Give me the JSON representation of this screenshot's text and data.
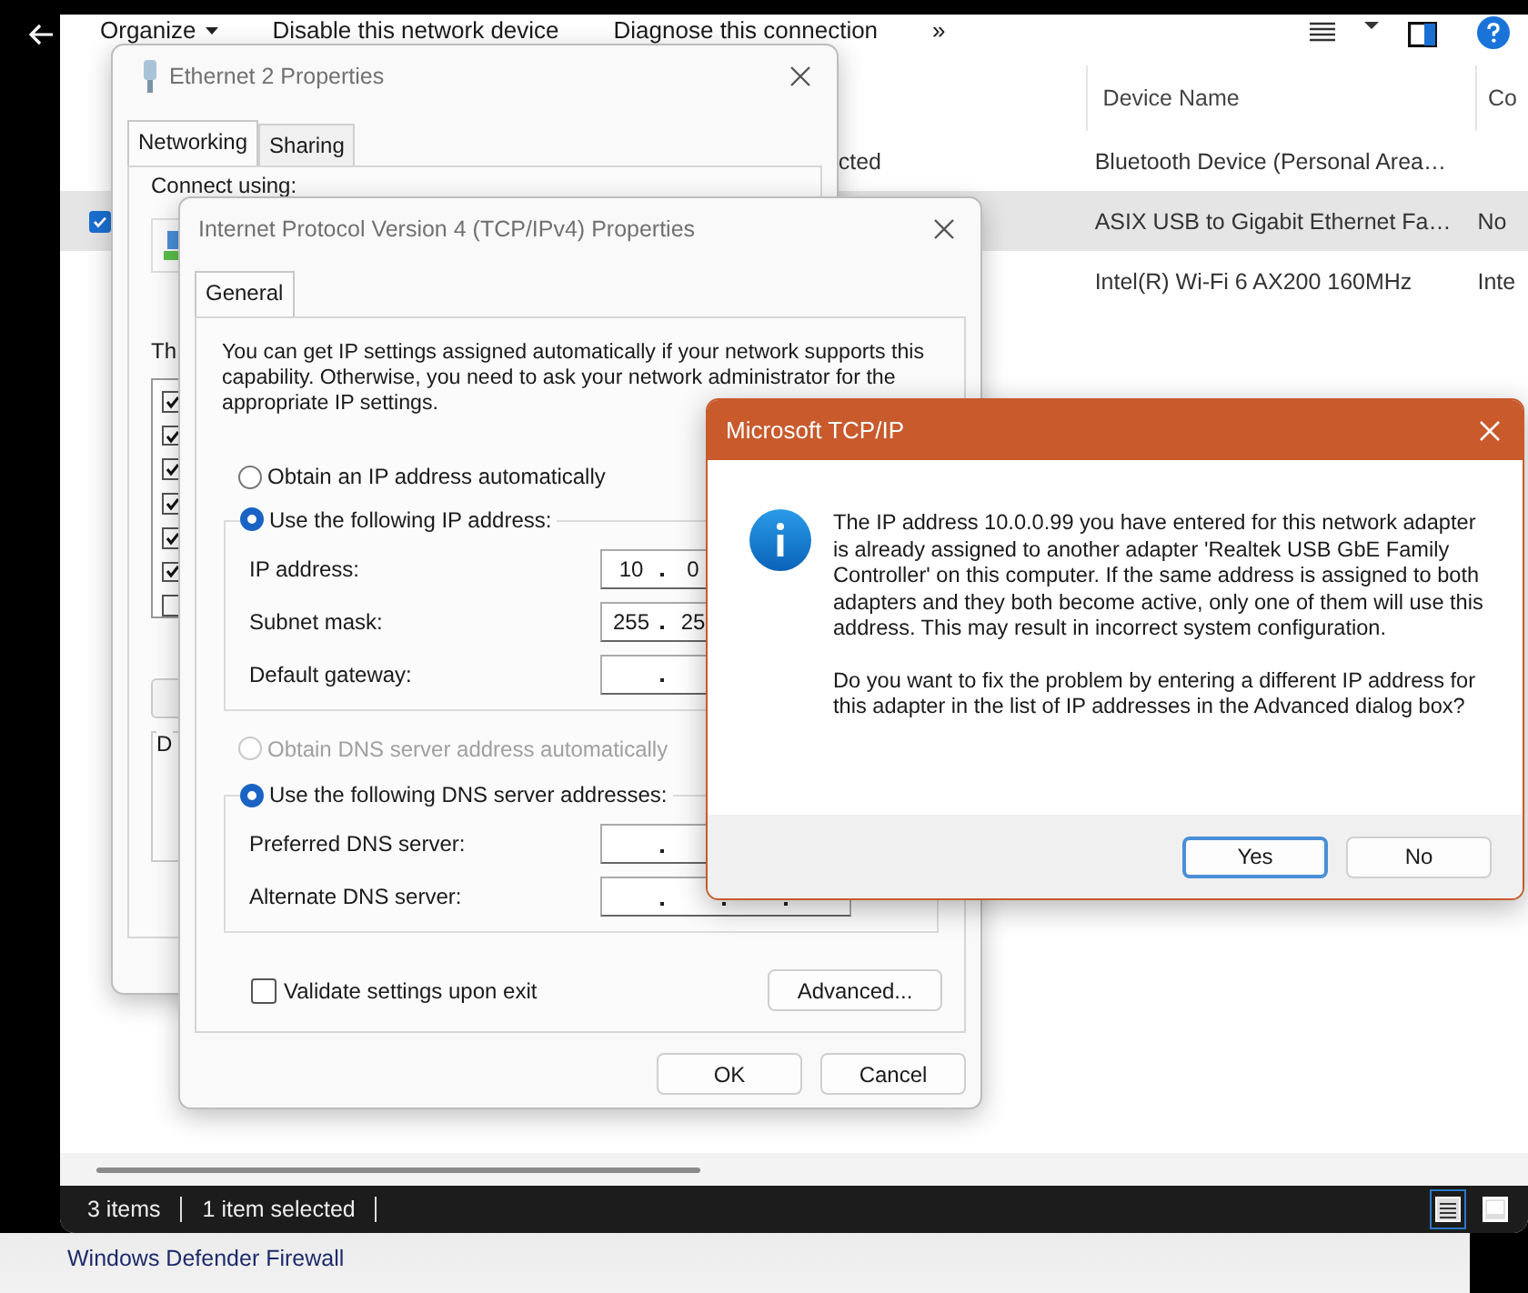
{
  "explorer": {
    "toolbar": [
      {
        "label": "Organize",
        "kind": "menu"
      },
      {
        "label": "Disable this network device",
        "kind": "command"
      },
      {
        "label": "Diagnose this connection",
        "kind": "command"
      },
      {
        "label": "»",
        "kind": "overflow"
      }
    ],
    "columns": [
      "Device Name",
      "Co"
    ],
    "rows": [
      {
        "column_1": "cted",
        "device_name": "Bluetooth Device (Personal Area…",
        "checked": false,
        "selected": false
      },
      {
        "device_name": "ASIX USB to Gigabit Ethernet Fa…",
        "column_3": "No",
        "checked": true,
        "selected": true
      },
      {
        "device_name": "Intel(R) Wi-Fi 6 AX200 160MHz",
        "column_3": "Inte",
        "checked": false,
        "selected": false
      }
    ],
    "status_bar": {
      "item_count": "3 items",
      "selection": "1 item selected"
    },
    "views": [
      {
        "kind": "details",
        "selected": true
      },
      {
        "kind": "tiles",
        "selected": false
      }
    ]
  },
  "footer_link": "Windows Defender Firewall",
  "ethernet_properties": {
    "title": "Ethernet 2 Properties",
    "tabs": [
      {
        "label": "Networking",
        "selected": true
      },
      {
        "label": "Sharing",
        "selected": false
      }
    ],
    "connect_label": "Connect using:",
    "components_label": "Th",
    "components": [
      {
        "checked": true
      },
      {
        "checked": true
      },
      {
        "checked": true
      },
      {
        "checked": true
      },
      {
        "checked": true
      },
      {
        "checked": true
      },
      {
        "checked": false
      }
    ],
    "group_label": "D"
  },
  "ipv4_properties": {
    "title": "Internet Protocol Version 4 (TCP/IPv4) Properties",
    "tabs": [
      {
        "label": "General",
        "selected": true
      }
    ],
    "intro": "You can get IP settings assigned automatically if your network supports this capability. Otherwise, you need to ask your network administrator for the appropriate IP settings.",
    "ip_auto": {
      "label": "Obtain an IP address automatically",
      "selected": false,
      "disabled": false
    },
    "ip_manual": {
      "label": "Use the following IP address:",
      "selected": true,
      "disabled": false,
      "fields": [
        {
          "label": "IP address:",
          "octets": [
            "10",
            "0"
          ]
        },
        {
          "label": "Subnet mask:",
          "octets": [
            "255",
            "25"
          ]
        },
        {
          "label": "Default gateway:"
        }
      ]
    },
    "dns_auto": {
      "label": "Obtain DNS server address automatically",
      "selected": false,
      "disabled": true
    },
    "dns_manual": {
      "label": "Use the following DNS server addresses:",
      "selected": true,
      "disabled": false,
      "fields": [
        {
          "label": "Preferred DNS server:"
        },
        {
          "label": "Alternate DNS server:"
        }
      ]
    },
    "validate": {
      "label": "Validate settings upon exit",
      "checked": false
    },
    "advanced_button": "Advanced...",
    "ok_button": "OK",
    "cancel_button": "Cancel"
  },
  "dialog": {
    "title": "Microsoft TCP/IP",
    "message": [
      "The IP address 10.0.0.99 you have entered for this network adapter is already assigned to another adapter 'Realtek USB GbE Family Controller' on this computer. If the same address is assigned to both adapters and they both become active, only one of them will use this address.  This may result in incorrect system configuration.",
      "Do you want to fix the problem by entering a different IP address for this adapter in the list of IP addresses in the Advanced dialog box?"
    ],
    "buttons": [
      {
        "label": "Yes",
        "default": true
      },
      {
        "label": "No",
        "default": false
      }
    ]
  }
}
